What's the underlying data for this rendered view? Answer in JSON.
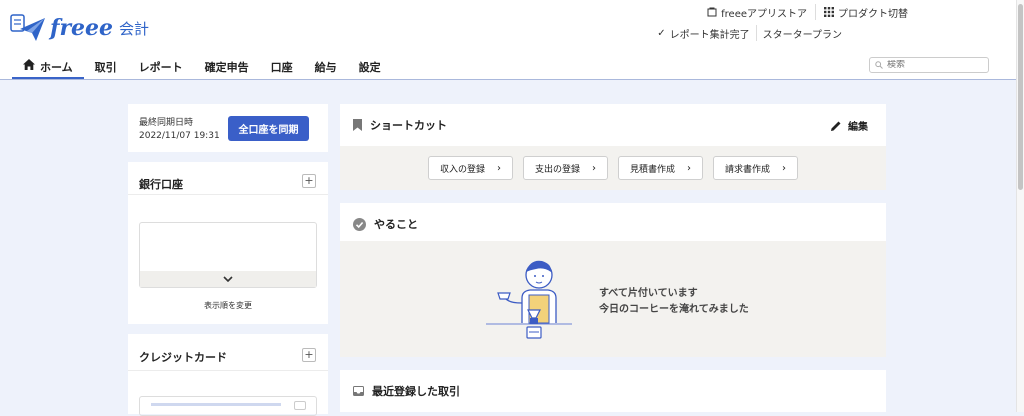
{
  "brand": {
    "name": "freee",
    "product": "会計"
  },
  "utility": {
    "appstore": "freeeアプリストア",
    "product_switch": "プロダクト切替",
    "report_status": "レポート集計完了",
    "plan": "スタータープラン"
  },
  "nav": {
    "tabs": [
      {
        "label": "ホーム"
      },
      {
        "label": "取引"
      },
      {
        "label": "レポート"
      },
      {
        "label": "確定申告"
      },
      {
        "label": "口座"
      },
      {
        "label": "給与"
      },
      {
        "label": "設定"
      }
    ],
    "active_index": 0
  },
  "search": {
    "placeholder": "検索"
  },
  "sync": {
    "last_sync_label": "最終同期日時",
    "last_sync_time": "2022/11/07 19:31",
    "button": "全口座を同期"
  },
  "bank": {
    "title": "銀行口座",
    "reorder": "表示順を変更"
  },
  "credit": {
    "title": "クレジットカード"
  },
  "shortcut": {
    "title": "ショートカット",
    "edit": "編集",
    "buttons": [
      "収入の登録",
      "支出の登録",
      "見積書作成",
      "請求書作成"
    ]
  },
  "todo": {
    "title": "やること",
    "line1": "すべて片付いています",
    "line2": "今日のコーヒーを淹れてみました"
  },
  "recent": {
    "title": "最近登録した取引"
  },
  "colors": {
    "primary": "#3a5fc8",
    "page_bg": "#eef2fb",
    "panel_alt": "#f3f2ef"
  }
}
